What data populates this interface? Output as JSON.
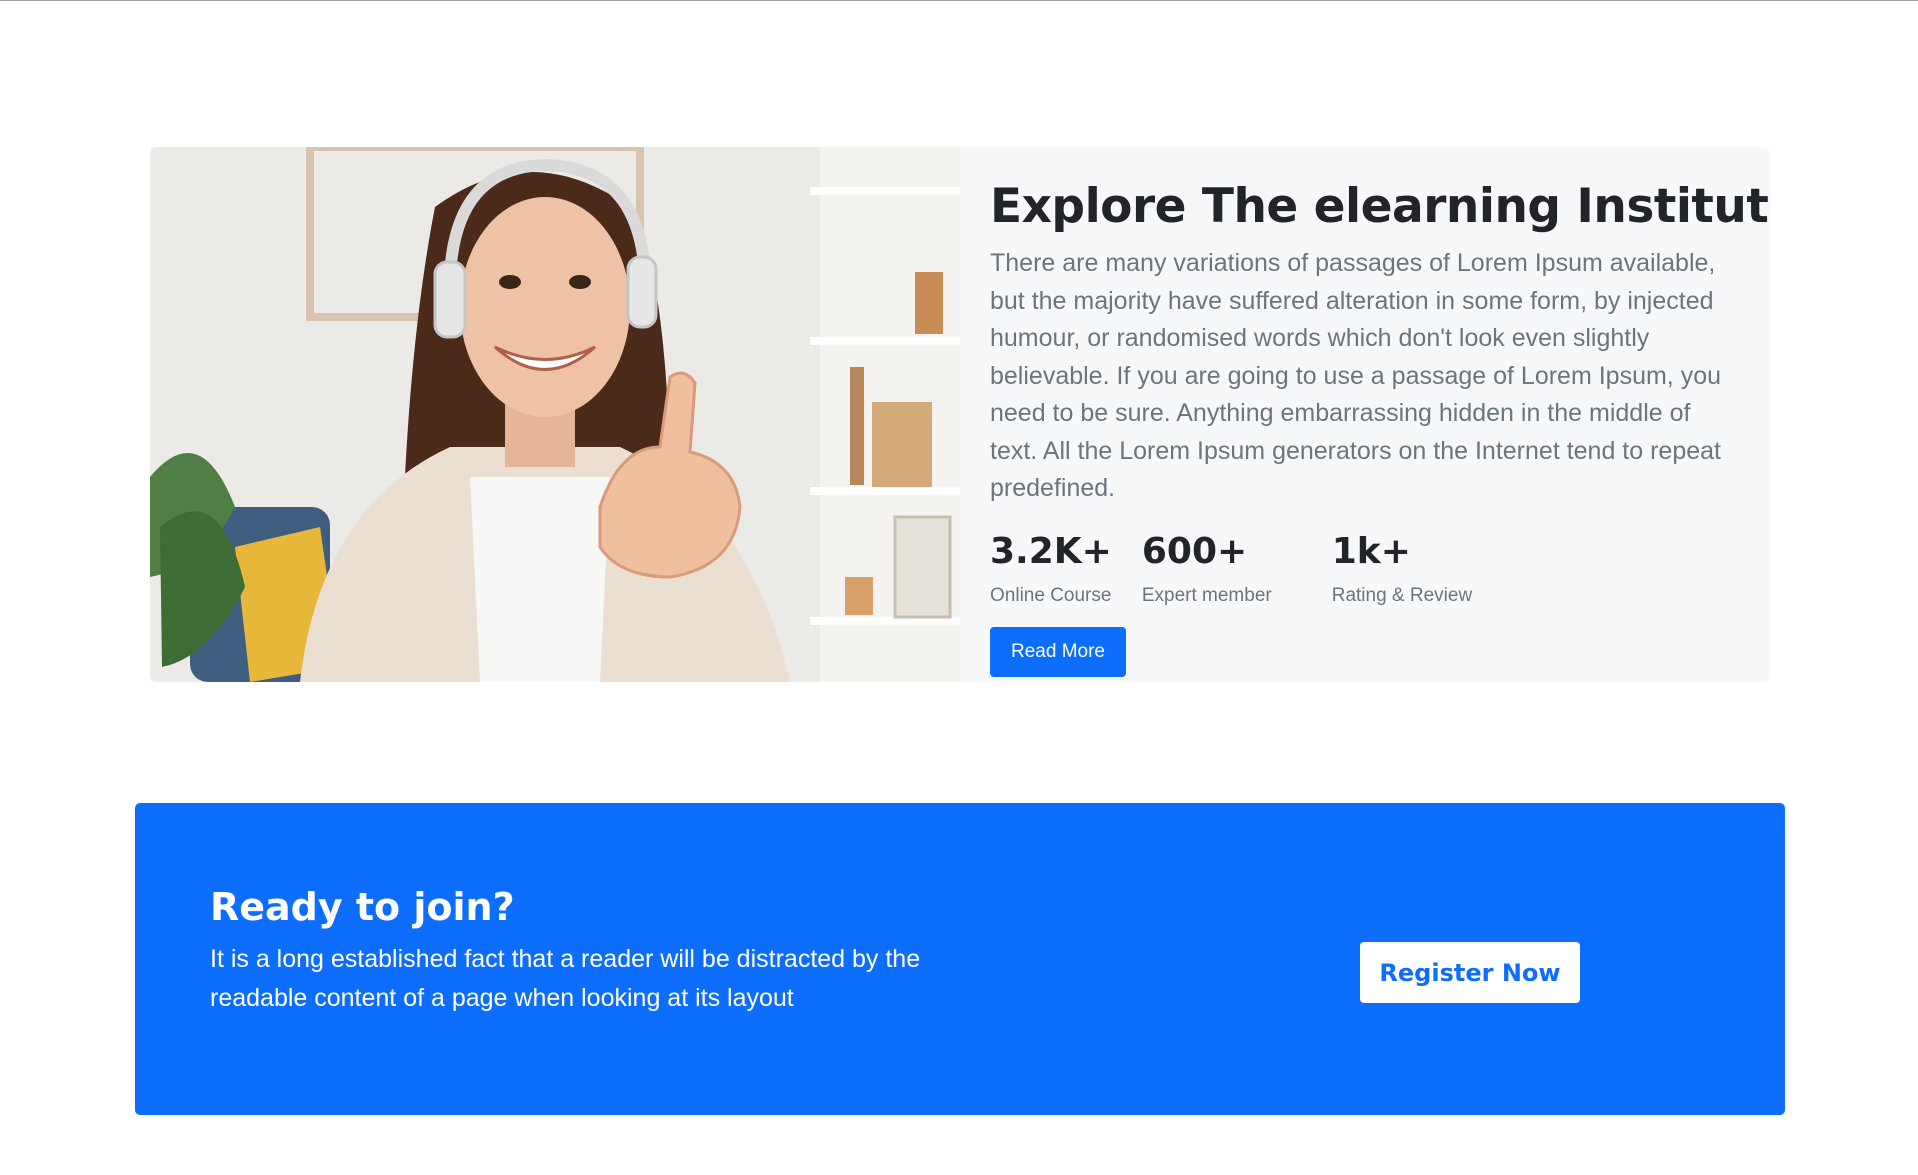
{
  "about": {
    "title": "Explore The elearning Institute",
    "description": "There are many variations of passages of Lorem Ipsum available, but the majority have suffered alteration in some form, by injected humour, or randomised words which don't look even slightly believable. If you are going to use a passage of Lorem Ipsum, you need to be sure. Anything embarrassing hidden in the middle of text. All the Lorem Ipsum generators on the Internet tend to repeat predefined.",
    "stats": [
      {
        "value": "3.2K+",
        "label": "Online Course"
      },
      {
        "value": "600+",
        "label": "Expert member"
      },
      {
        "value": "1k+",
        "label": "Rating & Review"
      }
    ],
    "read_more_label": "Read More"
  },
  "cta": {
    "title": "Ready to join?",
    "text": "It is a long established fact that a reader will be distracted by the readable content of a page when looking at its layout",
    "register_label": "Register Now"
  },
  "colors": {
    "primary": "#0d6efd",
    "heading": "#212529",
    "muted": "#6c757d",
    "panel": "#f7f8f9"
  }
}
